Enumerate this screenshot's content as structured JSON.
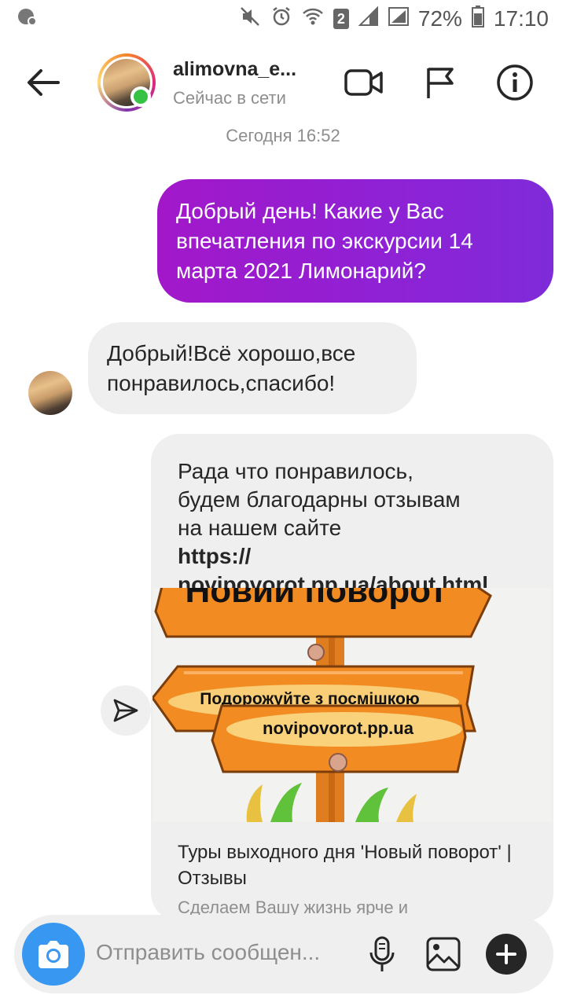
{
  "status_bar": {
    "battery_percent": "72%",
    "time": "17:10",
    "sim_badge": "2"
  },
  "header": {
    "username": "alimovna_e...",
    "presence": "Сейчас в сети"
  },
  "date_separator": "Сегодня 16:52",
  "messages": [
    {
      "direction": "outgoing",
      "text": "Добрый день! Какие у Вас\nвпечатления по экскурсии  14\nмарта 2021 Лимонарий?"
    },
    {
      "direction": "incoming",
      "text": "Добрый!Всё хорошо,все\nпонравилось,спасибо!"
    },
    {
      "direction": "outgoing",
      "text": "Рада что понравилось,\nбудем благодарны отзывам\nна нашем сайте",
      "url": "https://\nnovipovorot.pp.ua/about.html",
      "preview": {
        "sign_top": "Новий поворот",
        "sign_line1": "Подорожуйте з посмішкою",
        "sign_line2": "novipovorot.pp.ua",
        "title": "Туры выходного дня 'Новый поворот' | Отзывы",
        "description": "Сделаем Вашу жизнь ярче и"
      }
    }
  ],
  "composer": {
    "placeholder": "Отправить сообщен..."
  },
  "colors": {
    "outgoing_bubble": "#9a1dcf",
    "incoming_bubble": "#efefef",
    "camera_button": "#3897f0",
    "online": "#36c245"
  }
}
